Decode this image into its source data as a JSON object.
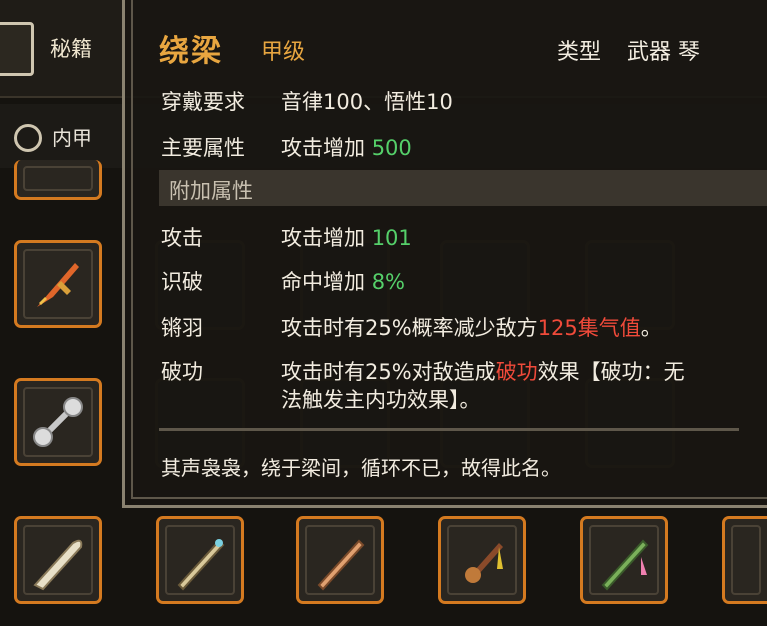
{
  "background": {
    "top_tab_label": "秘籍",
    "filter_label": "内甲"
  },
  "tooltip": {
    "title": "绕梁",
    "grade": "甲级",
    "type_label": "类型",
    "type_value": "武器 琴",
    "requirement": {
      "label": "穿戴要求",
      "value": "音律100、悟性10"
    },
    "main_attr": {
      "label": "主要属性",
      "text": "攻击增加 ",
      "number": "500"
    },
    "extra_header": "附加属性",
    "extras": [
      {
        "label": "攻击",
        "text": "攻击增加 ",
        "number": "101"
      },
      {
        "label": "识破",
        "text": "命中增加 ",
        "number": "8%"
      }
    ],
    "effect1": {
      "label": "锵羽",
      "pre": "攻击时有25%概率减少敌方",
      "highlight": "125集气值",
      "post": "。"
    },
    "effect2": {
      "label": "破功",
      "pre": "攻击时有25%对敌造成",
      "highlight": "破功",
      "post": "效果【破功：无",
      "line2": "法触发主内功效果】。"
    },
    "flavor": "其声袅袅，绕于梁间，循环不已，故得此名。"
  },
  "colors": {
    "title": "#e8a640",
    "value_green": "#55d06a",
    "value_red": "#f04a3a",
    "slot_border": "#d47a20"
  }
}
